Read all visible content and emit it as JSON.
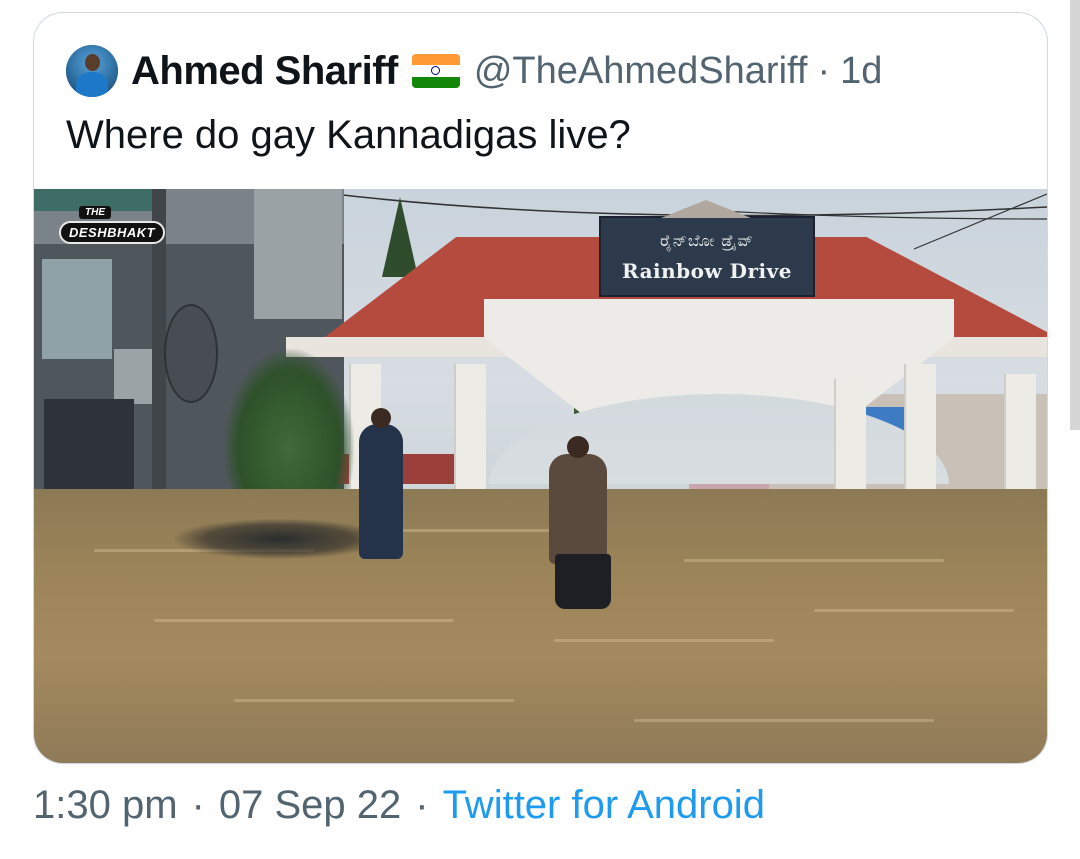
{
  "tweet": {
    "author": {
      "display_name": "Ahmed Shariff",
      "handle": "@TheAhmedShariff",
      "age": "1d",
      "separator": "·"
    },
    "text": "Where do gay Kannadigas live?",
    "media": {
      "watermark_top": "THE",
      "watermark_main": "DESHBHAKT",
      "sign_kannada": "ರೈನ್‌ಬೋ ಡ್ರೈವ್",
      "sign_english": "Rainbow Drive"
    }
  },
  "meta": {
    "time": "1:30 pm",
    "date": "07 Sep 22",
    "source": "Twitter for Android",
    "separator": "·"
  },
  "colors": {
    "name": "#0f1419",
    "secondary": "#536471",
    "link": "#1d9bf0",
    "card_border": "#cfd9de"
  },
  "icons": {
    "flag": "india-flag-icon",
    "avatar": "avatar"
  }
}
